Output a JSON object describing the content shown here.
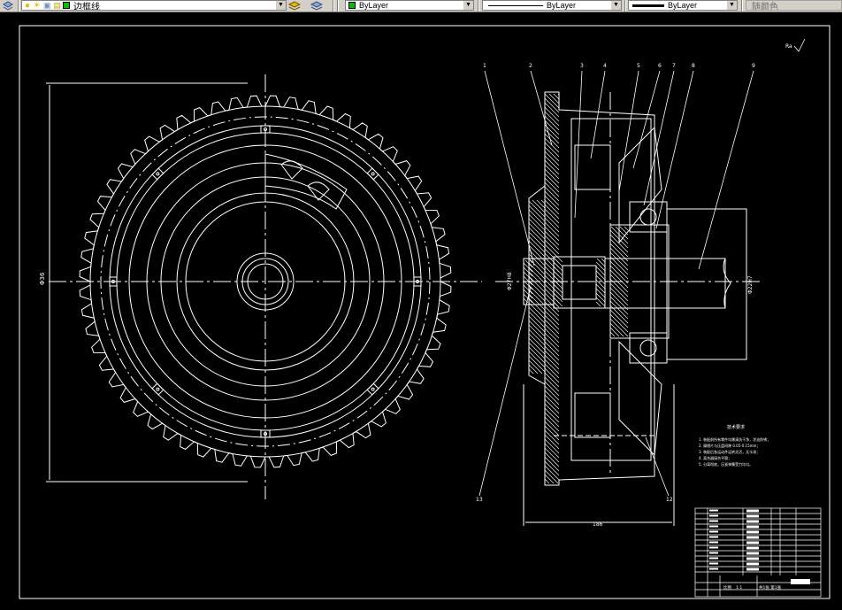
{
  "toolbar": {
    "layer_name": "边框线",
    "color_value": "ByLayer",
    "linetype_value": "ByLayer",
    "lineweight_value": "ByLayer",
    "plotstyle_value": "随颜色",
    "colors": {
      "layer_swatch": "#00c000",
      "color_swatch": "#00c000",
      "bg": "#d4d0c8"
    }
  },
  "drawing": {
    "left_dim_label": "Φ36",
    "bottom_dim_label": "186",
    "shaft_dim_left": "Φ27H8",
    "shaft_dim_right": "Φ22H7",
    "roughness_mark": "Ra",
    "callouts": [
      "1",
      "2",
      "3",
      "4",
      "5",
      "6",
      "7",
      "8",
      "9"
    ],
    "callout_bottom_left": "13",
    "callout_bottom_right": "12",
    "tech_title": "技术要求",
    "tech_notes": [
      "1. 装配前所有零件均需清洗干净，涂油防锈；",
      "2. 摩擦片与压盘间隙 0.05-0.15mm；",
      "3. 装配后各运动件运转灵活，无卡滞；",
      "4. 离合器接合平稳；",
      "5. 分离彻底，压紧弹簧受力均匀。"
    ],
    "title_block": {
      "scale_label": "比例",
      "scale_value": "1:1",
      "sheet_label": "共1张 第1张"
    },
    "colors": {
      "line": "#ffffff",
      "background": "#000000"
    }
  }
}
